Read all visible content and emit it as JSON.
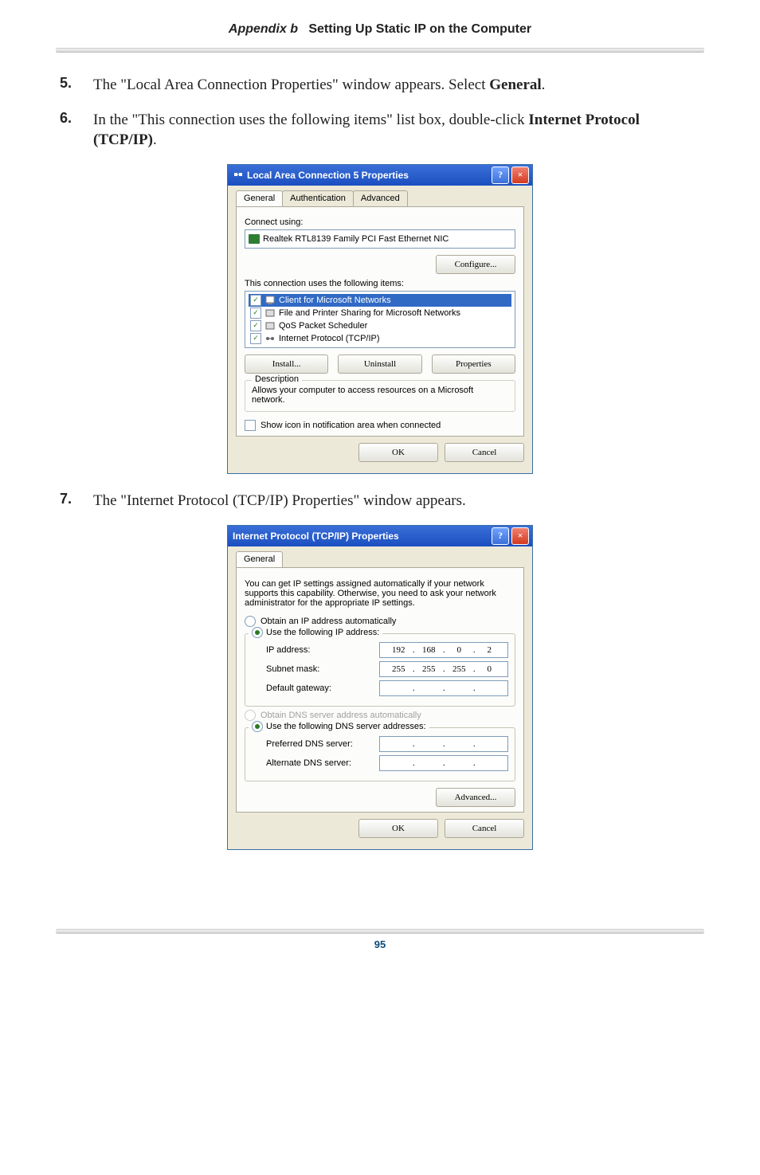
{
  "page": {
    "appendix_label": "Appendix b",
    "header_title": "Setting Up Static IP on the Computer",
    "number": "95"
  },
  "steps": {
    "s5": {
      "num": "5.",
      "text_a": "The \"Local Area Connection Properties\" window appears. Select ",
      "text_b": "General",
      "text_c": "."
    },
    "s6": {
      "num": "6.",
      "text_a": "In the \"This connection uses the following items\" list box, double-click ",
      "text_b": "Internet Protocol (TCP/IP)",
      "text_c": "."
    },
    "s7": {
      "num": "7.",
      "text_a": "The \"Internet Protocol (TCP/IP) Properties\" window appears."
    }
  },
  "lan_dialog": {
    "title": "Local Area Connection 5 Properties",
    "tabs": {
      "general": "General",
      "auth": "Authentication",
      "advanced": "Advanced"
    },
    "connect_using": "Connect using:",
    "adapter": "Realtek RTL8139 Family PCI Fast Ethernet NIC",
    "configure": "Configure...",
    "uses_label": "This connection uses the following items:",
    "items": [
      "Client for Microsoft Networks",
      "File and Printer Sharing for Microsoft Networks",
      "QoS Packet Scheduler",
      "Internet Protocol (TCP/IP)"
    ],
    "install": "Install...",
    "uninstall": "Uninstall",
    "properties": "Properties",
    "desc_title": "Description",
    "desc_text": "Allows your computer to access resources on a Microsoft network.",
    "show_icon": "Show icon in notification area when connected",
    "ok": "OK",
    "cancel": "Cancel"
  },
  "tcp_dialog": {
    "title": "Internet Protocol (TCP/IP) Properties",
    "tab_general": "General",
    "intro": "You can get IP settings assigned automatically if your network supports this capability. Otherwise, you need to ask your network administrator for the appropriate IP settings.",
    "obtain_auto": "Obtain an IP address automatically",
    "use_following": "Use the following IP address:",
    "ip_label": "IP address:",
    "subnet_label": "Subnet mask:",
    "gateway_label": "Default gateway:",
    "ip": {
      "a": "192",
      "b": "168",
      "c": "0",
      "d": "2"
    },
    "subnet": {
      "a": "255",
      "b": "255",
      "c": "255",
      "d": "0"
    },
    "gateway": {
      "a": "",
      "b": "",
      "c": "",
      "d": ""
    },
    "obtain_dns_auto": "Obtain DNS server address automatically",
    "use_following_dns": "Use the following DNS server addresses:",
    "pref_dns_label": "Preferred DNS server:",
    "alt_dns_label": "Alternate DNS server:",
    "advanced": "Advanced...",
    "ok": "OK",
    "cancel": "Cancel"
  }
}
